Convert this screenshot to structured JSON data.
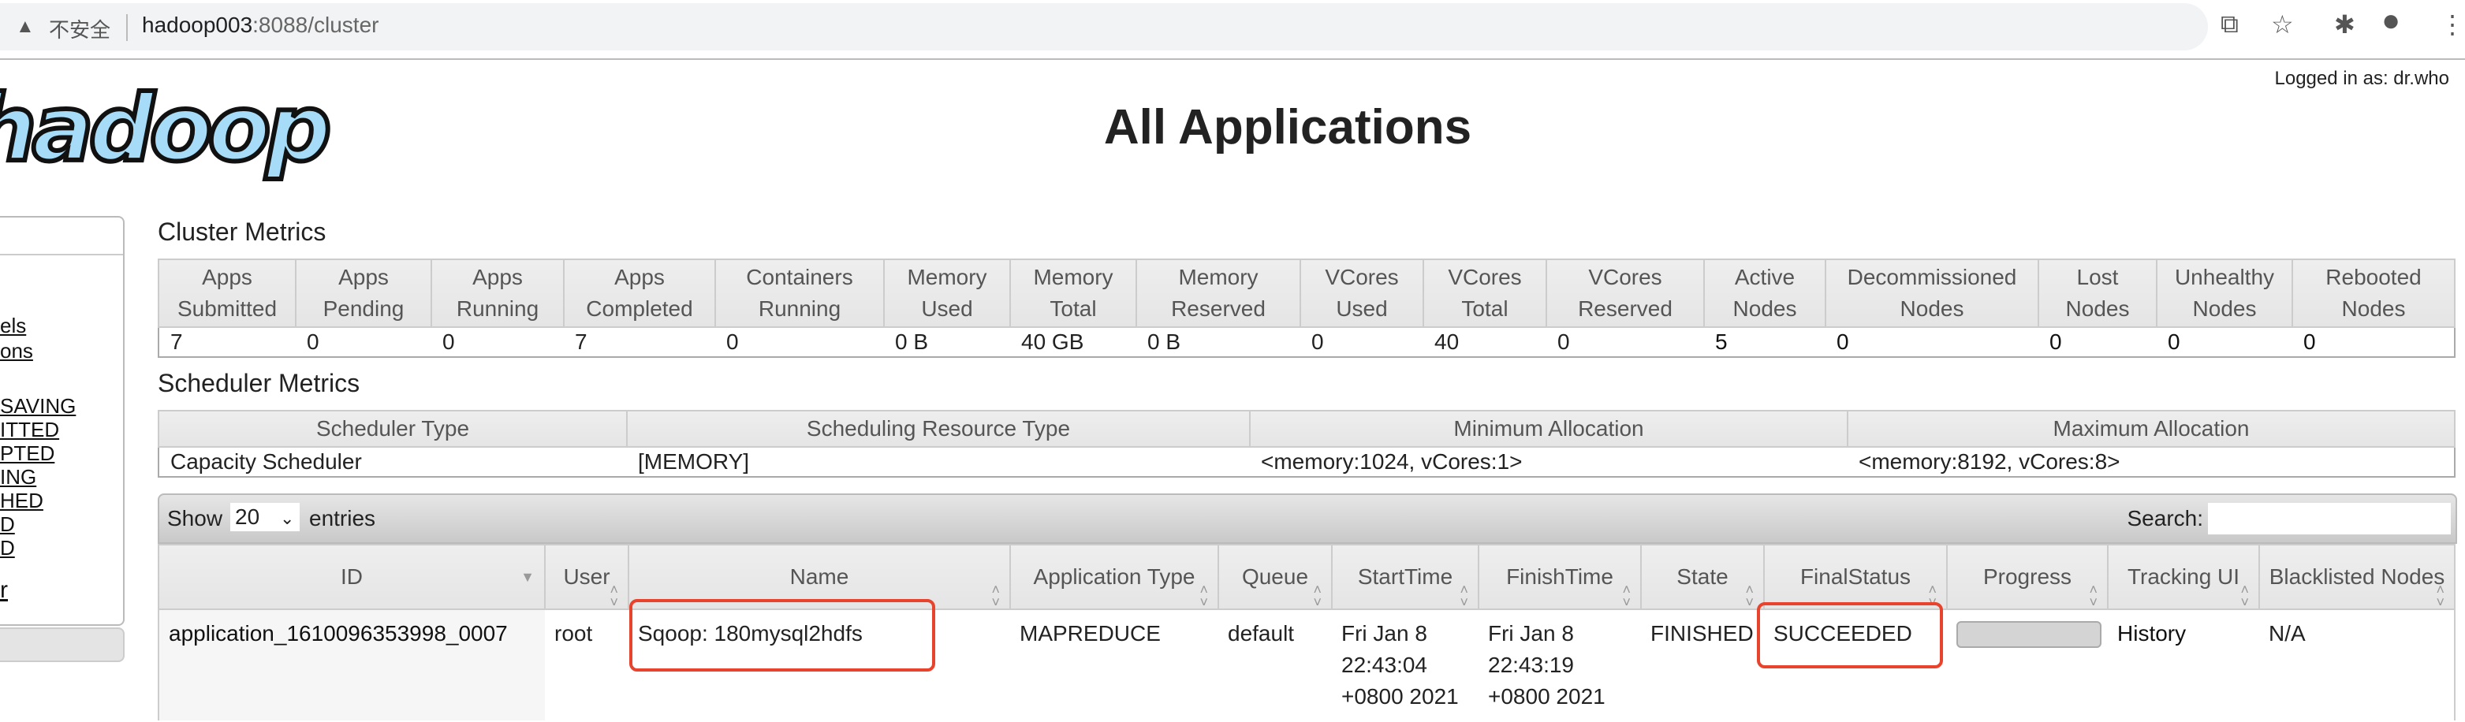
{
  "browser": {
    "insecure_label": "不安全",
    "url_host": "hadoop003",
    "url_path": ":8088/cluster",
    "icons": [
      "translate-icon",
      "star-icon",
      "extensions-icon",
      "profile-icon",
      "menu-icon"
    ]
  },
  "header": {
    "logged_in": "Logged in as: dr.who",
    "logo_text": "hadoop",
    "title": "All Applications"
  },
  "sidebar": {
    "items": [
      "els",
      "ons",
      "SAVING",
      "ITTED",
      "PTED",
      "ING",
      "HED",
      "D",
      "D",
      "r"
    ]
  },
  "cluster_metrics": {
    "title": "Cluster Metrics",
    "headers": [
      "Apps Submitted",
      "Apps Pending",
      "Apps Running",
      "Apps Completed",
      "Containers Running",
      "Memory Used",
      "Memory Total",
      "Memory Reserved",
      "VCores Used",
      "VCores Total",
      "VCores Reserved",
      "Active Nodes",
      "Decommissioned Nodes",
      "Lost Nodes",
      "Unhealthy Nodes",
      "Rebooted Nodes"
    ],
    "values": [
      "7",
      "0",
      "0",
      "7",
      "0",
      "0 B",
      "40 GB",
      "0 B",
      "0",
      "40",
      "0",
      "5",
      "0",
      "0",
      "0",
      "0"
    ]
  },
  "scheduler_metrics": {
    "title": "Scheduler Metrics",
    "headers": [
      "Scheduler Type",
      "Scheduling Resource Type",
      "Minimum Allocation",
      "Maximum Allocation"
    ],
    "values": [
      "Capacity Scheduler",
      "[MEMORY]",
      "<memory:1024, vCores:1>",
      "<memory:8192, vCores:8>"
    ]
  },
  "apps": {
    "show_label": "Show",
    "entries_value": "20",
    "entries_label": "entries",
    "search_label": "Search:",
    "search_value": "",
    "headers": [
      "ID",
      "User",
      "Name",
      "Application Type",
      "Queue",
      "StartTime",
      "FinishTime",
      "State",
      "FinalStatus",
      "Progress",
      "Tracking UI",
      "Blacklisted Nodes"
    ],
    "rows": [
      {
        "id": "application_1610096353998_0007",
        "user": "root",
        "name": "Sqoop: 180mysql2hdfs",
        "type": "MAPREDUCE",
        "queue": "default",
        "start": "Fri Jan 8 22:43:04 +0800 2021",
        "finish": "Fri Jan 8 22:43:19 +0800 2021",
        "state": "FINISHED",
        "final_status": "SUCCEEDED",
        "progress": 100,
        "tracking": "History",
        "blacklisted": "N/A"
      }
    ]
  },
  "highlight_color": "#e8432c"
}
